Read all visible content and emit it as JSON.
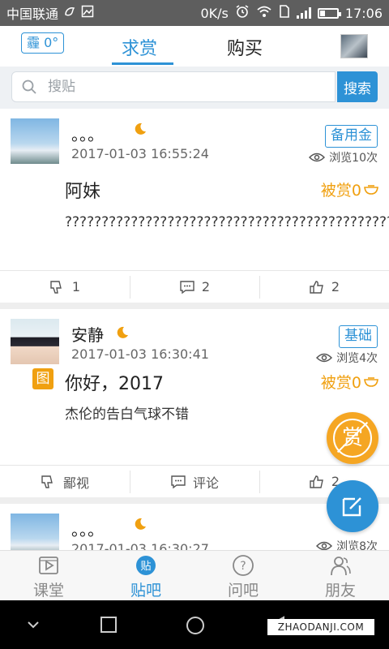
{
  "status_bar": {
    "carrier": "中国联通",
    "speed": "0K/s",
    "time": "17:06"
  },
  "header": {
    "coin_badge": "霾 0°",
    "tabs": [
      {
        "label": "求赏",
        "active": true
      },
      {
        "label": "购买",
        "active": false
      }
    ]
  },
  "search": {
    "placeholder": "搜贴",
    "button_label": "搜索"
  },
  "posts": [
    {
      "name": "。。。",
      "time": "2017-01-03 16:55:24",
      "level": "备用金",
      "views": "浏览10次",
      "title": "阿妹",
      "reward": "被赏0",
      "body": "?????????????????????????????????????????????????????????????????????",
      "actions": [
        {
          "label": "1"
        },
        {
          "label": "2"
        },
        {
          "label": "2"
        }
      ]
    },
    {
      "name": "安静",
      "time": "2017-01-03 16:30:41",
      "level": "基础",
      "views": "浏览4次",
      "has_image_tag": true,
      "image_tag": "图",
      "title": "你好，2017",
      "reward": "被赏0",
      "body": "杰伦的告白气球不错",
      "actions": [
        {
          "label": "鄙视"
        },
        {
          "label": "评论"
        },
        {
          "label": "2"
        }
      ]
    },
    {
      "name": "。。。",
      "time": "2017-01-03 16:30:27",
      "views": "浏览8次"
    }
  ],
  "fab": {
    "reward_label": "赏"
  },
  "bottom_nav": [
    {
      "label": "课堂",
      "icon": "video-icon",
      "active": false
    },
    {
      "label": "贴吧",
      "icon": "tie-icon",
      "active": true,
      "icon_text": "贴"
    },
    {
      "label": "问吧",
      "icon": "question-icon",
      "active": false,
      "icon_text": "?"
    },
    {
      "label": "朋友",
      "icon": "friends-icon",
      "active": false
    }
  ],
  "watermark": "ZHAODANJI.COM",
  "colors": {
    "accent": "#2d92d6",
    "reward": "#f0a010",
    "status_bar": "#5e5e5e"
  }
}
